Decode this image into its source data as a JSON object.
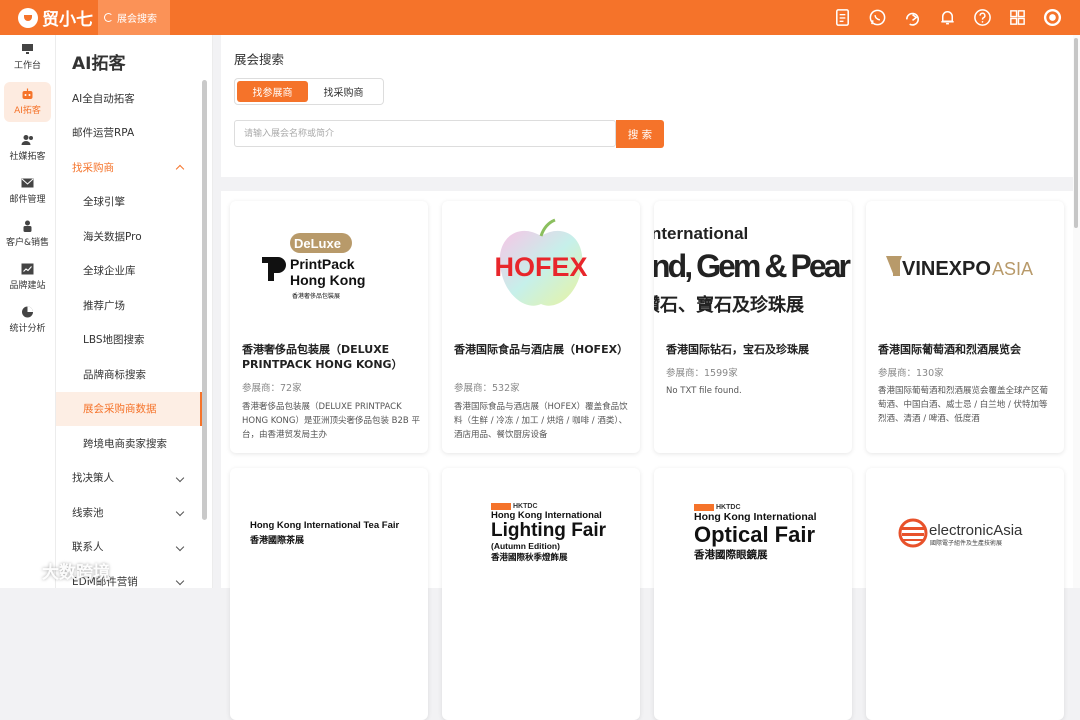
{
  "app": {
    "name": "贸小七",
    "tab": "展会搜索"
  },
  "colors": {
    "accent": "#f5732a",
    "accent_light": "#fdebe0"
  },
  "topbar_icons": [
    "document-icon",
    "whatsapp-icon",
    "share-icon",
    "bell-icon",
    "help-icon",
    "grid-apps-icon",
    "avatar-icon"
  ],
  "leftnav": [
    {
      "label": "工作台",
      "icon": "monitor-icon"
    },
    {
      "label": "AI拓客",
      "icon": "robot-icon"
    },
    {
      "label": "社媒拓客",
      "icon": "users-icon"
    },
    {
      "label": "邮件管理",
      "icon": "mail-icon"
    },
    {
      "label": "客户&销售",
      "icon": "person-icon"
    },
    {
      "label": "品牌建站",
      "icon": "chart-box-icon"
    },
    {
      "label": "统计分析",
      "icon": "pie-icon"
    }
  ],
  "subnav": {
    "title": "AI拓客",
    "items": [
      {
        "label": "AI全自动拓客"
      },
      {
        "label": "邮件运营RPA"
      },
      {
        "label": "找采购商"
      },
      {
        "label": "全球引擎"
      },
      {
        "label": "海关数据Pro"
      },
      {
        "label": "全球企业库"
      },
      {
        "label": "推荐广场"
      },
      {
        "label": "LBS地图搜索"
      },
      {
        "label": "品牌商标搜索"
      },
      {
        "label": "展会采购商数据"
      },
      {
        "label": "跨境电商卖家搜索"
      },
      {
        "label": "找决策人"
      },
      {
        "label": "线索池"
      },
      {
        "label": "联系人"
      },
      {
        "label": "EDM邮件营销"
      }
    ]
  },
  "search": {
    "title": "展会搜索",
    "tabs": [
      "找参展商",
      "找采购商"
    ],
    "placeholder": "请输入展会名称或简介",
    "button": "搜 索"
  },
  "count_label": "参展商：",
  "cards": [
    {
      "logo_text": [
        "DeLuxe",
        "PrintPack",
        "Hong Kong",
        "香港奢侈品包裝展"
      ],
      "title": "香港奢侈品包装展（DELUXE PRINTPACK HONG KONG）",
      "count": "72家",
      "desc": "香港奢侈品包装展（DELUXE PRINTPACK HONG KONG）是亚洲顶尖奢侈品包装 B2B 平台，由香港贸发局主办"
    },
    {
      "logo_text": [
        "HOFEX"
      ],
      "title": "香港国际食品与酒店展（HOFEX）",
      "count": "532家",
      "desc": "香港国际食品与酒店展（HOFEX）覆盖食品饮料（生鲜 / 冷冻 / 加工 / 烘焙 / 咖啡 / 酒类）、酒店用品、餐饮厨房设备"
    },
    {
      "logo_text": [
        "nternational",
        "nd, Gem & Pear",
        "鑽石、寶石及珍珠展"
      ],
      "title": "香港国际钻石，宝石及珍珠展",
      "count": "1599家",
      "desc": "No TXT file found."
    },
    {
      "logo_text": [
        "VINEXPO",
        "ASIA"
      ],
      "title": "香港国际葡萄酒和烈酒展览会",
      "count": "130家",
      "desc": "香港国际葡萄酒和烈酒展览会覆盖全球产区葡萄酒、中国白酒、威士忌 / 白兰地 / 伏特加等烈酒、清酒 / 啤酒、低度酒"
    },
    {
      "logo_text": [
        "Hong Kong International Tea Fair",
        "香港國際茶展"
      ]
    },
    {
      "logo_text": [
        "HKTDC",
        "Hong Kong International",
        "Lighting Fair",
        "(Autumn Edition)",
        "香港國際秋季燈飾展"
      ]
    },
    {
      "logo_text": [
        "HKTDC",
        "Hong Kong International",
        "Optical Fair",
        "香港國際眼鏡展"
      ]
    },
    {
      "logo_text": [
        "electronicAsia",
        "國際電子組件及生產技術展"
      ]
    }
  ],
  "watermark": "大数跨境"
}
